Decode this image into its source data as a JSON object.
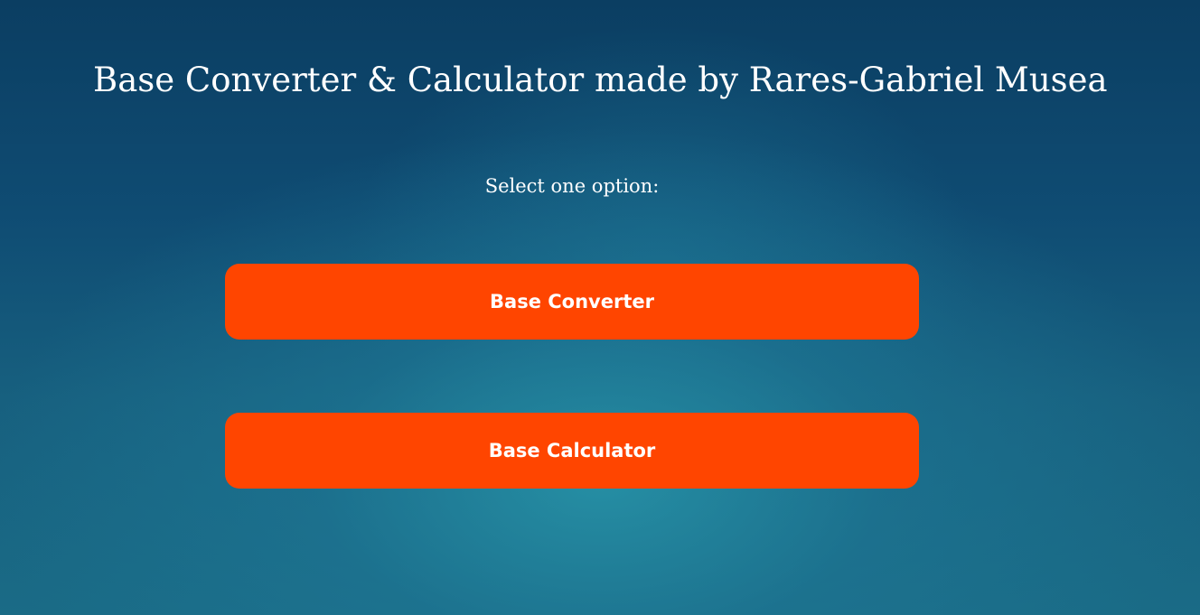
{
  "header": {
    "title": "Base Converter & Calculator made by Rares-Gabriel Musea"
  },
  "main": {
    "prompt": "Select one option:",
    "options": [
      {
        "label": "Base Converter"
      },
      {
        "label": "Base Calculator"
      }
    ]
  },
  "colors": {
    "button_bg": "#ff4500",
    "text": "#ffffff",
    "background_dark": "#0b3e62",
    "background_light": "#2896aa"
  }
}
